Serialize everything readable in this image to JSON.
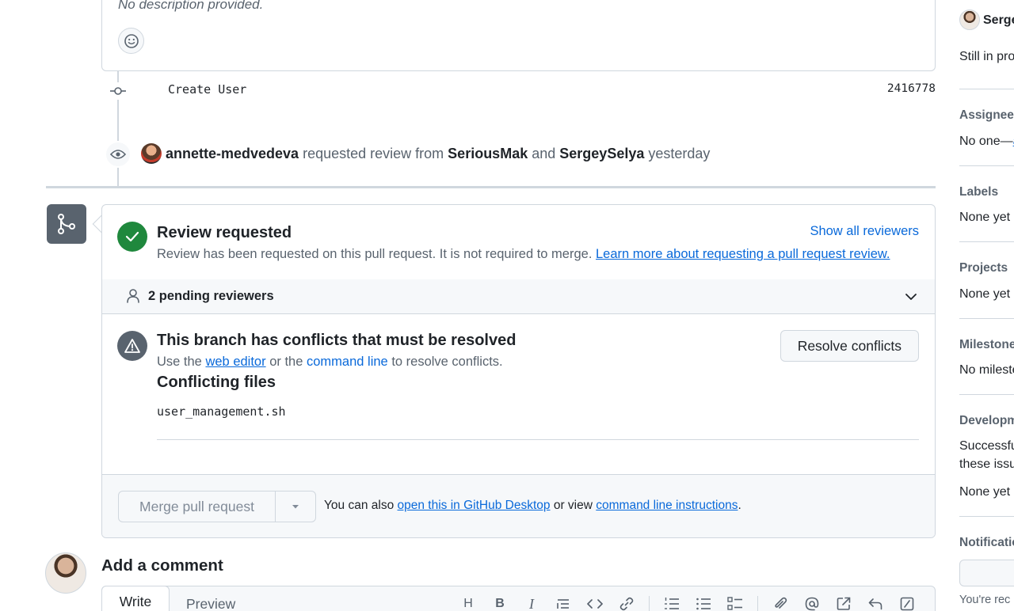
{
  "description": {
    "text": "No description provided."
  },
  "commit": {
    "message": "Create User",
    "sha": "2416778"
  },
  "review_event": {
    "actor": "annette-medvedeva",
    "action": "requested review from",
    "reviewer1": "SeriousMak",
    "conjunction": "and",
    "reviewer2": "SergeySelya",
    "time": "yesterday"
  },
  "merge_box": {
    "review": {
      "title": "Review requested",
      "subtitle": "Review has been requested on this pull request. It is not required to merge.",
      "learn_more": "Learn more about requesting a pull request review.",
      "show_all": "Show all reviewers"
    },
    "pending": {
      "label": "2 pending reviewers"
    },
    "conflicts": {
      "title": "This branch has conflicts that must be resolved",
      "sub_prefix": "Use the",
      "web_editor": "web editor",
      "sub_or": "or the",
      "command_line": "command line",
      "sub_suffix": "to resolve conflicts.",
      "files_title": "Conflicting files",
      "file": "user_management.sh",
      "resolve_button": "Resolve conflicts"
    },
    "merge": {
      "button": "Merge pull request",
      "hint_prefix": "You can also",
      "desktop_link": "open this in GitHub Desktop",
      "hint_mid": "or view",
      "cli_link": "command line instructions",
      "hint_end": "."
    }
  },
  "comment": {
    "heading": "Add a comment",
    "tab_write": "Write",
    "tab_preview": "Preview",
    "toolbar_heading": "H",
    "toolbar_bold": "B",
    "toolbar_italic": "I"
  },
  "sidebar": {
    "reviewer_name": "Serge",
    "status_text": "Still in pro",
    "assignees_head": "Assignees",
    "assignees_prefix": "No one—",
    "assignees_link": "a",
    "labels_head": "Labels",
    "labels_value": "None yet",
    "projects_head": "Projects",
    "projects_value": "None yet",
    "milestone_head": "Milestone",
    "milestone_value": "No mileste",
    "development_head": "Developm",
    "development_text1": "Successfu",
    "development_text2": "these issu",
    "development_value": "None yet",
    "notifications_head": "Notificatio",
    "notifications_text": "You're rec"
  }
}
